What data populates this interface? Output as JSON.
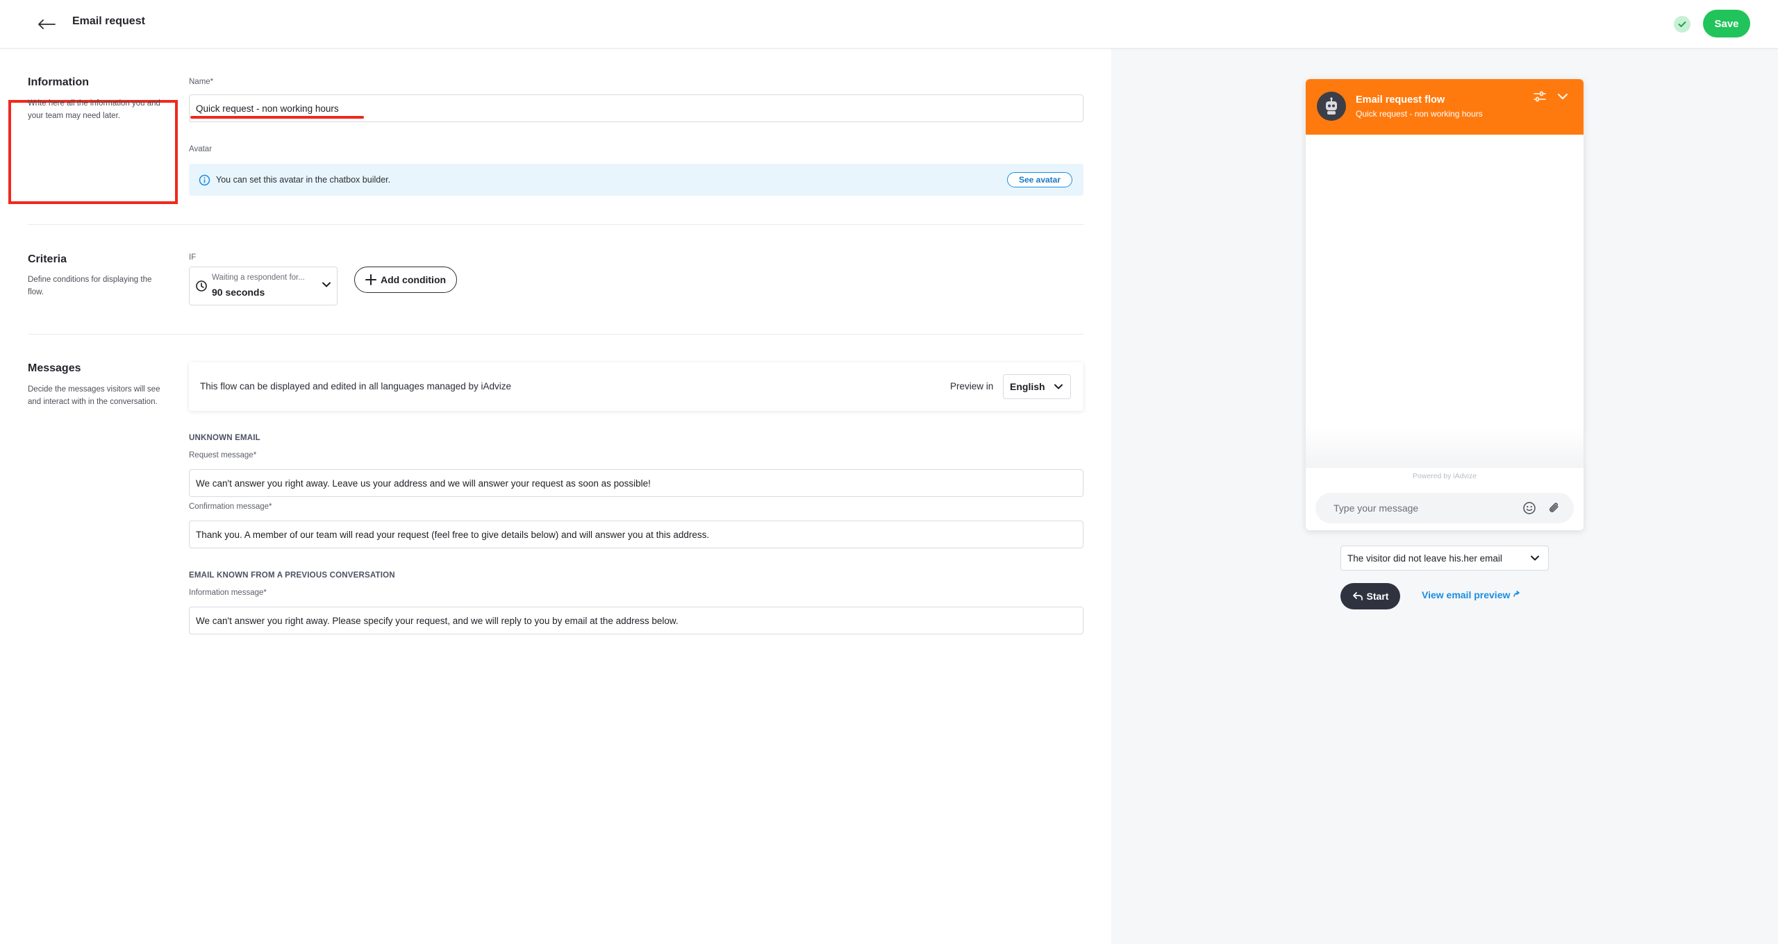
{
  "header": {
    "title": "Email request",
    "save_label": "Save",
    "back_icon": "arrow-left-icon",
    "status_icon": "check-circle-icon"
  },
  "information": {
    "title": "Information",
    "description": "Write here all the information you and your team may need later.",
    "name_label": "Name*",
    "name_value": "Quick request - non working hours",
    "avatar_label": "Avatar",
    "avatar_info": "You can set this avatar in the chatbox builder.",
    "see_avatar_label": "See avatar"
  },
  "criteria": {
    "title": "Criteria",
    "description": "Define conditions for displaying the flow.",
    "if_label": "IF",
    "condition_hint": "Waiting a respondent for...",
    "condition_value": "90 seconds",
    "add_condition_label": "Add condition"
  },
  "messages": {
    "title": "Messages",
    "description": "Decide the messages visitors will see and interact with in the conversation.",
    "languages_info": "This flow can be displayed and edited in all languages managed by iAdvize",
    "preview_in_label": "Preview in",
    "language_value": "English",
    "unknown_email_heading": "UNKNOWN EMAIL",
    "request_label": "Request message*",
    "request_value": "We can't answer you right away. Leave us your address and we will answer your request as soon as possible!",
    "confirmation_label": "Confirmation message*",
    "confirmation_value": "Thank you. A member of our team will read your request (feel free to give details below) and will answer you at this address.",
    "known_email_heading": "EMAIL KNOWN FROM A PREVIOUS CONVERSATION",
    "information_label": "Information message*",
    "information_value": "We can't answer you right away. Please specify your request, and we will reply to you by email at the address below."
  },
  "preview": {
    "chat_title": "Email request flow",
    "chat_subtitle": "Quick request - non working hours",
    "powered_by": "Powered by iAdvize",
    "input_placeholder": "Type your message",
    "scenario_value": "The visitor did not leave his.her email",
    "start_label": "Start",
    "email_preview_label": "View email preview",
    "header_color": "#ff7a0e"
  },
  "colors": {
    "save": "#21c45a",
    "link": "#1b8ede",
    "highlight": "#ee2a1d"
  }
}
